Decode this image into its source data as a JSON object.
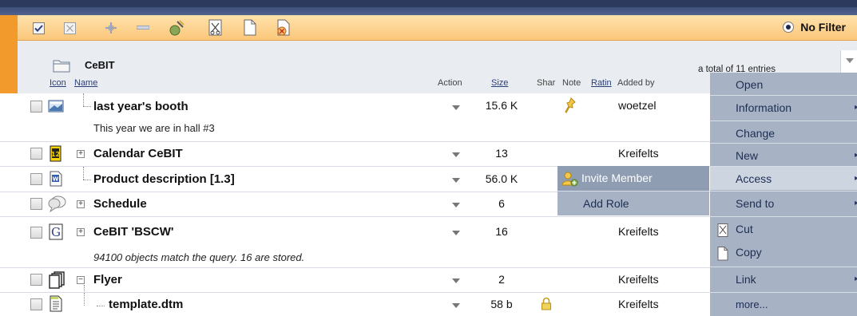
{
  "toolbar": {
    "buttons": [
      "select-all-icon",
      "deselect-icon",
      "expand-all-icon",
      "collapse-all-icon",
      "cut-icon",
      "scissors-icon",
      "copy-icon",
      "delete-icon"
    ],
    "filter_label": "No Filter"
  },
  "folder": {
    "name": "CeBIT",
    "total_text": "a total of 11 entries"
  },
  "columns": {
    "icon": "Icon",
    "name": "Name",
    "action": "Action",
    "size": "Size",
    "share": "Shar",
    "note": "Note",
    "rating": "Ratin",
    "added_by": "Added by"
  },
  "rows": [
    {
      "name": "last year's booth",
      "size": "15.6 K",
      "added_by": "woetzel",
      "description": "This year we are in hall #3",
      "icon": "image-icon",
      "has_note": true
    },
    {
      "name": "Calendar CeBIT",
      "size": "13",
      "added_by": "Kreifelts",
      "icon": "calendar-icon"
    },
    {
      "name": "Product description [1.3]",
      "size": "56.0 K",
      "added_by": "",
      "icon": "word-doc-icon"
    },
    {
      "name": "Schedule",
      "size": "6",
      "added_by": "",
      "icon": "discussion-icon"
    },
    {
      "name": "CeBIT 'BSCW'",
      "size": "16",
      "added_by": "Kreifelts",
      "description": "94100 objects match the query. 16 are stored.",
      "icon": "google-search-icon"
    },
    {
      "name": "Flyer",
      "size": "2",
      "added_by": "Kreifelts",
      "icon": "documents-icon"
    },
    {
      "name": "template.dtm",
      "size": "58 b",
      "added_by": "Kreifelts",
      "icon": "template-icon",
      "locked": true
    }
  ],
  "context_menu": {
    "items": [
      "Open",
      "Information",
      "Change",
      "New",
      "Access",
      "Send to",
      "Cut",
      "Copy",
      "Link",
      "more..."
    ]
  },
  "submenu": {
    "invite": "Invite Member",
    "add_role": "Add Role"
  },
  "colors": {
    "accent_orange": "#f39a2d",
    "menu_bg": "#a7b3c5",
    "menu_highlight": "#cdd5e1",
    "header_navy": "#2c3a5e"
  }
}
